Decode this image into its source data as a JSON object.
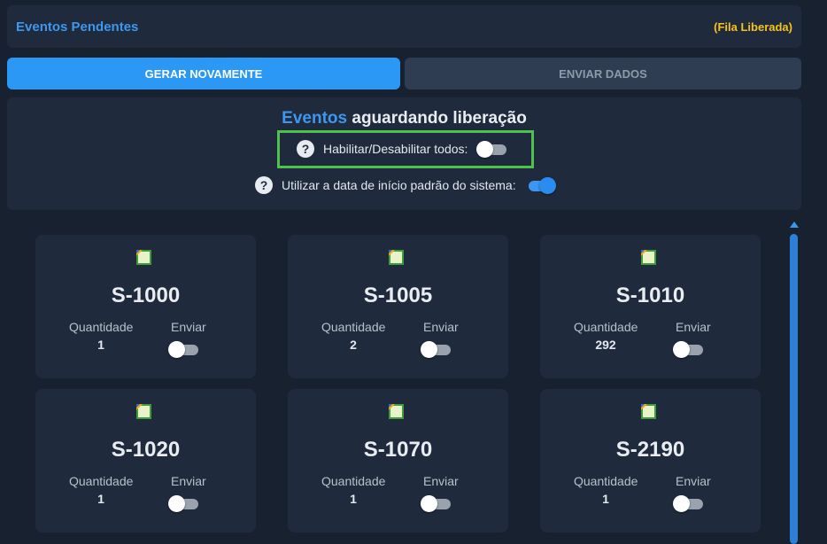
{
  "header": {
    "title": "Eventos Pendentes",
    "status": "(Fila Liberada)"
  },
  "buttons": {
    "gerar": "GERAR NOVAMENTE",
    "enviar": "ENVIAR DADOS"
  },
  "panel": {
    "heading_accent": "Eventos",
    "heading_rest": " aguardando liberação",
    "toggle_all_label": "Habilitar/Desabilitar todos:",
    "toggle_all_on": false,
    "default_date_label": "Utilizar a data de início padrão do sistema:",
    "default_date_on": true
  },
  "cards": [
    {
      "code": "S-1000",
      "qty_label": "Quantidade",
      "qty": "1",
      "send_label": "Enviar",
      "send_on": false
    },
    {
      "code": "S-1005",
      "qty_label": "Quantidade",
      "qty": "2",
      "send_label": "Enviar",
      "send_on": false
    },
    {
      "code": "S-1010",
      "qty_label": "Quantidade",
      "qty": "292",
      "send_label": "Enviar",
      "send_on": false
    },
    {
      "code": "S-1020",
      "qty_label": "Quantidade",
      "qty": "1",
      "send_label": "Enviar",
      "send_on": false
    },
    {
      "code": "S-1070",
      "qty_label": "Quantidade",
      "qty": "1",
      "send_label": "Enviar",
      "send_on": false
    },
    {
      "code": "S-2190",
      "qty_label": "Quantidade",
      "qty": "1",
      "send_label": "Enviar",
      "send_on": false
    }
  ],
  "colors": {
    "accent": "#3d97f0",
    "status": "#f7c21c",
    "highlight": "#4ec14e"
  }
}
